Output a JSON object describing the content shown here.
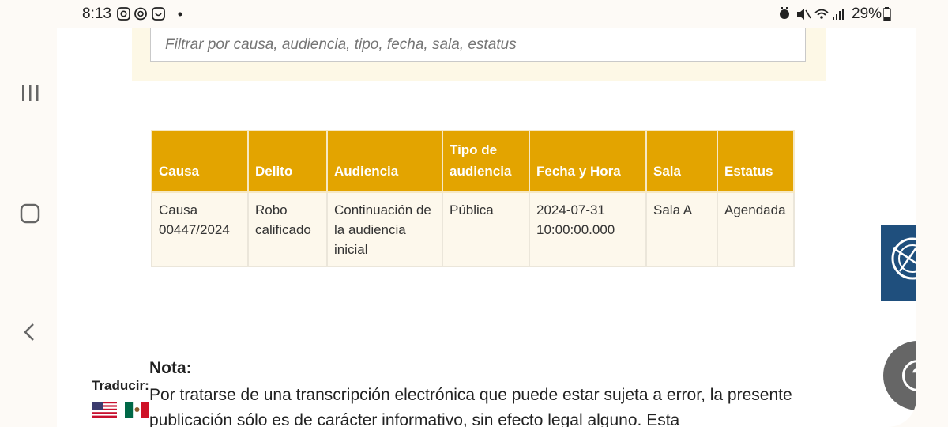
{
  "status_bar": {
    "time": "8:13",
    "left_icons": [
      "instagram-icon",
      "threads-icon",
      "app-icon",
      "dot"
    ],
    "right_icons": [
      "alarm-icon",
      "mute-icon",
      "wifi-icon",
      "signal-icon"
    ],
    "battery": "29%"
  },
  "filter": {
    "placeholder": "Filtrar por causa, audiencia, tipo, fecha, sala, estatus"
  },
  "table": {
    "headers": [
      "Causa",
      "Delito",
      "Audiencia",
      "Tipo de audiencia",
      "Fecha y Hora",
      "Sala",
      "Estatus"
    ],
    "rows": [
      [
        "Causa 00447/2024",
        "Robo calificado",
        "Continuación de la audiencia inicial",
        "Pública",
        "2024-07-31 10:00:00.000",
        "Sala A",
        "Agendada"
      ]
    ]
  },
  "nota": {
    "title": "Nota:",
    "text": "Por tratarse de una transcripción electrónica que puede  estar sujeta a error, la presente publicación sólo es de carácter  informativo, sin efecto legal alguno. Esta"
  },
  "translate": {
    "label": "Traducir:",
    "flags": [
      "us-flag-icon",
      "mx-flag-icon"
    ]
  },
  "help": {
    "icon": "?"
  },
  "colors": {
    "header": "#e3a400",
    "band": "#fdf8e6",
    "widget": "#1f4f7d",
    "help": "#666666"
  }
}
